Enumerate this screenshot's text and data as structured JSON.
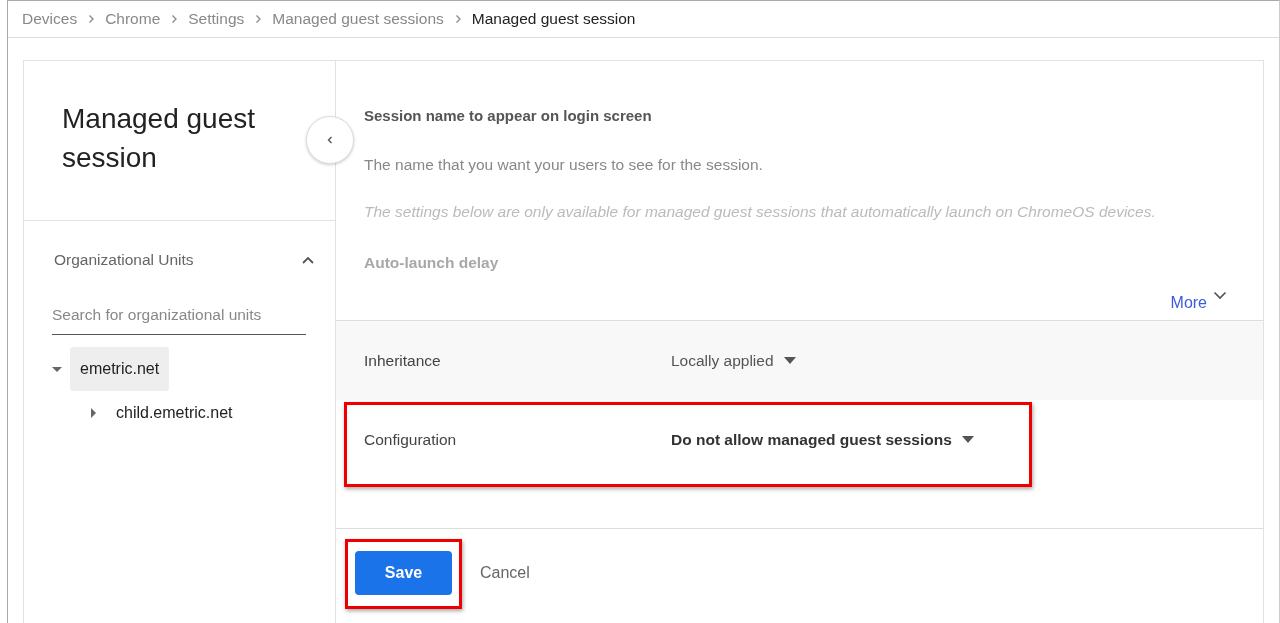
{
  "breadcrumb": [
    {
      "label": "Devices",
      "current": false
    },
    {
      "label": "Chrome",
      "current": false
    },
    {
      "label": "Settings",
      "current": false
    },
    {
      "label": "Managed guest sessions",
      "current": false
    },
    {
      "label": "Managed guest session",
      "current": true
    }
  ],
  "sidebar": {
    "title": "Managed guest session",
    "section": {
      "label": "Organizational Units",
      "expanded": true
    },
    "search": {
      "placeholder": "Search for organizational units"
    },
    "tree": [
      {
        "label": "emetric.net",
        "selected": true,
        "expanded": true,
        "children": [
          {
            "label": "child.emetric.net",
            "selected": false,
            "expanded": false
          }
        ]
      }
    ]
  },
  "description": [
    {
      "kind": "heading",
      "text": "Session name to appear on login screen"
    },
    {
      "kind": "text",
      "text": "The name that you want your users to see for the session."
    },
    {
      "kind": "note",
      "text": "The settings below are only available for managed guest sessions that automatically launch on ChromeOS devices."
    },
    {
      "kind": "faded",
      "text": "Auto-launch delay"
    }
  ],
  "more": {
    "label": "More"
  },
  "settings": [
    {
      "kind": "inheritance",
      "label": "Inheritance",
      "value": "Locally applied",
      "highlighted": false
    },
    {
      "kind": "policy",
      "label": "Configuration",
      "value": "Do not allow managed guest sessions",
      "highlighted": true
    }
  ],
  "actions": [
    {
      "kind": "primary",
      "label": "Save",
      "highlighted": true
    },
    {
      "kind": "secondary",
      "label": "Cancel",
      "highlighted": false
    }
  ]
}
